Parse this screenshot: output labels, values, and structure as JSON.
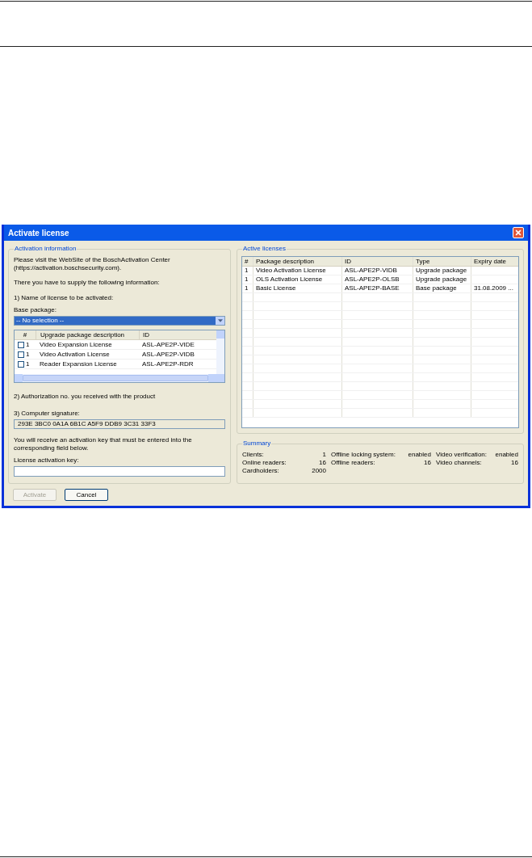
{
  "dialog": {
    "title": "Activate license",
    "activation_info": {
      "title": "Activation information",
      "intro": [
        "Please visit the WebSite of the BoschActivation Center",
        "(https://activation.boschsecurity.com)."
      ],
      "supply_text": "There you have to supply the following information:",
      "step1": "1) Name of license to be activated:",
      "base_label": "Base package:",
      "base_value": "-- No selection --",
      "upgrade_columns": [
        "#",
        "Upgrade package description",
        "ID"
      ],
      "upgrade_rows": [
        {
          "checked": false,
          "count": "1",
          "description": "Video Expansion License",
          "id": "ASL-APE2P-VIDE"
        },
        {
          "checked": false,
          "count": "1",
          "description": "Video Activation License",
          "id": "ASL-APE2P-VIDB"
        },
        {
          "checked": false,
          "count": "1",
          "description": "Reader Expansion License",
          "id": "ASL-APE2P-RDR"
        }
      ],
      "step2": "2) Authorization no. you received with the product",
      "step3": "3) Computer signature:",
      "signature": "293E 3BC0 0A1A 6B1C A5F9 DDB9 3C31 33F3",
      "key_text": [
        "You will receive an activation key that must be entered into the",
        "corresponding field below."
      ],
      "key_label": "License activation key:"
    },
    "active_licenses": {
      "title": "Active licenses",
      "columns": [
        "#",
        "Package description",
        "ID",
        "Type",
        "Expiry date"
      ],
      "rows": [
        [
          "1",
          "Video Activation License",
          "ASL-APE2P-VIDB",
          "Upgrade package",
          ""
        ],
        [
          "1",
          "OLS Activation License",
          "ASL-APE2P-OLSB",
          "Upgrade package",
          ""
        ],
        [
          "1",
          "Basic License",
          "ASL-APE2P-BASE",
          "Base package",
          "31.08.2009 ..."
        ]
      ]
    },
    "summary": {
      "title": "Summary",
      "columns": [
        [
          {
            "label": "Clients:",
            "value": "1"
          },
          {
            "label": "Online readers:",
            "value": "16"
          },
          {
            "label": "Cardholders:",
            "value": "2000"
          }
        ],
        [
          {
            "label": "Offline locking system:",
            "value": "enabled"
          },
          {
            "label": "Offline readers:",
            "value": "16"
          }
        ],
        [
          {
            "label": "Video verification:",
            "value": "enabled"
          },
          {
            "label": "Video channels:",
            "value": "16"
          }
        ]
      ]
    },
    "buttons": [
      {
        "label": "Activate",
        "disabled": true
      },
      {
        "label": "Cancel",
        "disabled": false
      }
    ]
  }
}
